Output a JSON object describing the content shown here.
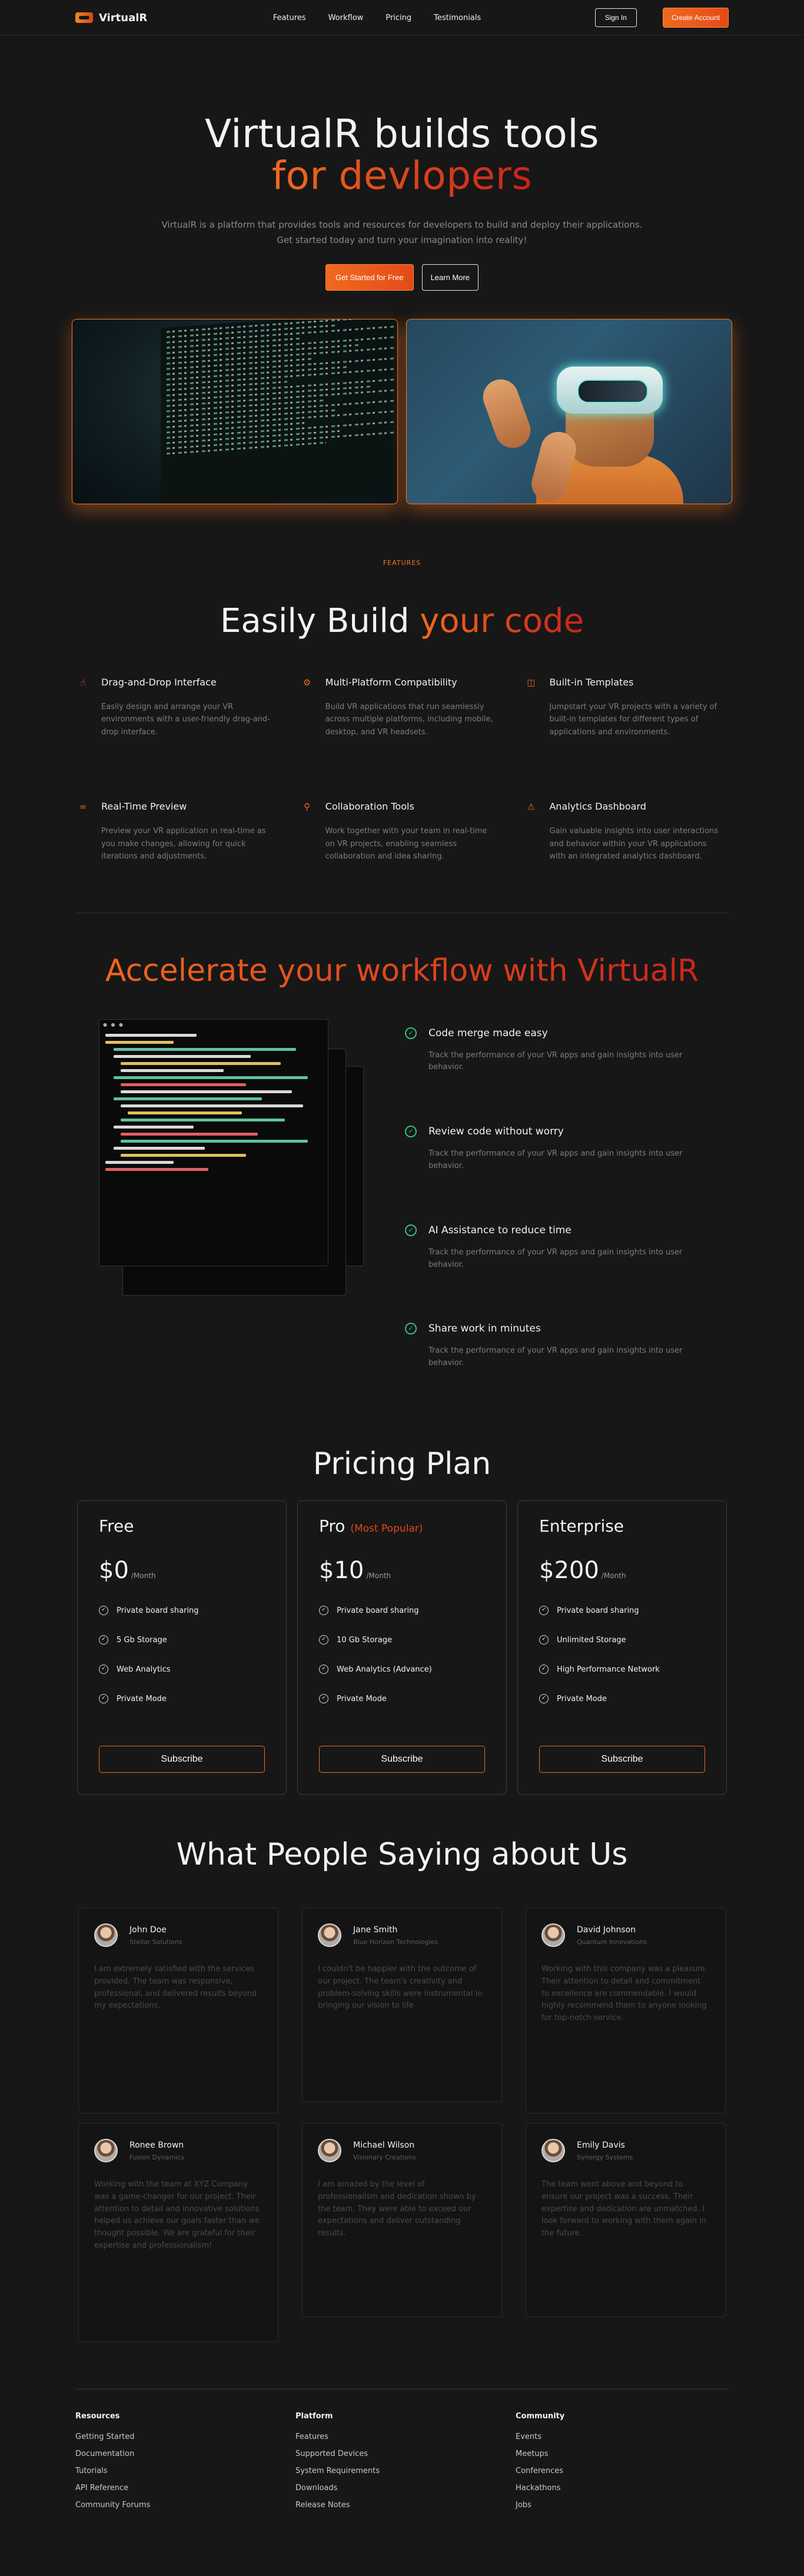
{
  "nav": {
    "brand": "VirtualR",
    "links": [
      "Features",
      "Workflow",
      "Pricing",
      "Testimonials"
    ],
    "sign_in": "Sign In",
    "create_account": "Create Account"
  },
  "hero": {
    "title_line1": "VirtualR builds tools",
    "title_line2": "for devlopers",
    "subtitle": "VirtualR is a platform that provides tools and resources for developers to build and deploy their applications. Get started today and turn your imagination into reality!",
    "cta_primary": "Get Started for Free",
    "cta_secondary": "Learn More"
  },
  "features": {
    "tag": "FEATURES",
    "title_white": "Easily Build",
    "title_orange": "your code",
    "items": [
      {
        "icon": "drag-icon",
        "title": "Drag-and-Drop Interface",
        "text": "Easily design and arrange your VR environments with a user-friendly drag-and-drop interface."
      },
      {
        "icon": "multi-platform-icon",
        "title": "Multi-Platform Compatibility",
        "text": "Build VR applications that run seamlessly across multiple platforms, including mobile, desktop, and VR headsets."
      },
      {
        "icon": "template-icon",
        "title": "Built-in Templates",
        "text": "Jumpstart your VR projects with a variety of built-in templates for different types of applications and environments."
      },
      {
        "icon": "preview-icon",
        "title": "Real-Time Preview",
        "text": "Preview your VR application in real-time as you make changes, allowing for quick iterations and adjustments."
      },
      {
        "icon": "collaboration-icon",
        "title": "Collaboration Tools",
        "text": "Work together with your team in real-time on VR projects, enabling seamless collaboration and idea sharing."
      },
      {
        "icon": "analytics-icon",
        "title": "Analytics Dashboard",
        "text": "Gain valuable insights into user interactions and behavior within your VR applications with an integrated analytics dashboard."
      }
    ]
  },
  "workflow": {
    "title": "Accelerate your workflow with VirtualR",
    "items": [
      {
        "title": "Code merge made easy",
        "text": "Track the performance of your VR apps and gain insights into user behavior."
      },
      {
        "title": "Review code without worry",
        "text": "Track the performance of your VR apps and gain insights into user behavior."
      },
      {
        "title": "AI Assistance to reduce time",
        "text": "Track the performance of your VR apps and gain insights into user behavior."
      },
      {
        "title": "Share work in minutes",
        "text": "Track the performance of your VR apps and gain insights into user behavior."
      }
    ]
  },
  "pricing": {
    "title": "Pricing Plan",
    "plans": [
      {
        "name": "Free",
        "badge": "",
        "price": "$0",
        "period": "/Month",
        "features": [
          "Private board sharing",
          "5 Gb Storage",
          "Web Analytics",
          "Private Mode"
        ],
        "cta": "Subscribe"
      },
      {
        "name": "Pro",
        "badge": "(Most Popular)",
        "price": "$10",
        "period": "/Month",
        "features": [
          "Private board sharing",
          "10 Gb Storage",
          "Web Analytics (Advance)",
          "Private Mode"
        ],
        "cta": "Subscribe"
      },
      {
        "name": "Enterprise",
        "badge": "",
        "price": "$200",
        "period": "/Month",
        "features": [
          "Private board sharing",
          "Unlimited Storage",
          "High Performance Network",
          "Private Mode"
        ],
        "cta": "Subscribe"
      }
    ]
  },
  "testimonials": {
    "title": "What People Saying about Us",
    "items": [
      {
        "name": "John Doe",
        "company": "Stellar Solutions",
        "text": "I am extremely satisfied with the services provided. The team was responsive, professional, and delivered results beyond my expectations."
      },
      {
        "name": "Jane Smith",
        "company": "Blue Horizon Technologies",
        "text": "I couldn't be happier with the outcome of our project. The team's creativity and problem-solving skills were instrumental in bringing our vision to life"
      },
      {
        "name": "David Johnson",
        "company": "Quantum Innovations",
        "text": "Working with this company was a pleasure. Their attention to detail and commitment to excellence are commendable. I would highly recommend them to anyone looking for top-notch service."
      },
      {
        "name": "Ronee Brown",
        "company": "Fusion Dynamics",
        "text": "Working with the team at XYZ Company was a game-changer for our project. Their attention to detail and innovative solutions helped us achieve our goals faster than we thought possible. We are grateful for their expertise and professionalism!"
      },
      {
        "name": "Michael Wilson",
        "company": "Visionary Creations",
        "text": "I am amazed by the level of professionalism and dedication shown by the team. They were able to exceed our expectations and deliver outstanding results."
      },
      {
        "name": "Emily Davis",
        "company": "Synergy Systems",
        "text": "The team went above and beyond to ensure our project was a success. Their expertise and dedication are unmatched. I look forward to working with them again in the future."
      }
    ]
  },
  "footer": {
    "columns": [
      {
        "title": "Resources",
        "links": [
          "Getting Started",
          "Documentation",
          "Tutorials",
          "API Reference",
          "Community Forums"
        ]
      },
      {
        "title": "Platform",
        "links": [
          "Features",
          "Supported Devices",
          "System Requirements",
          "Downloads",
          "Release Notes"
        ]
      },
      {
        "title": "Community",
        "links": [
          "Events",
          "Meetups",
          "Conferences",
          "Hackathons",
          "Jobs"
        ]
      }
    ]
  }
}
